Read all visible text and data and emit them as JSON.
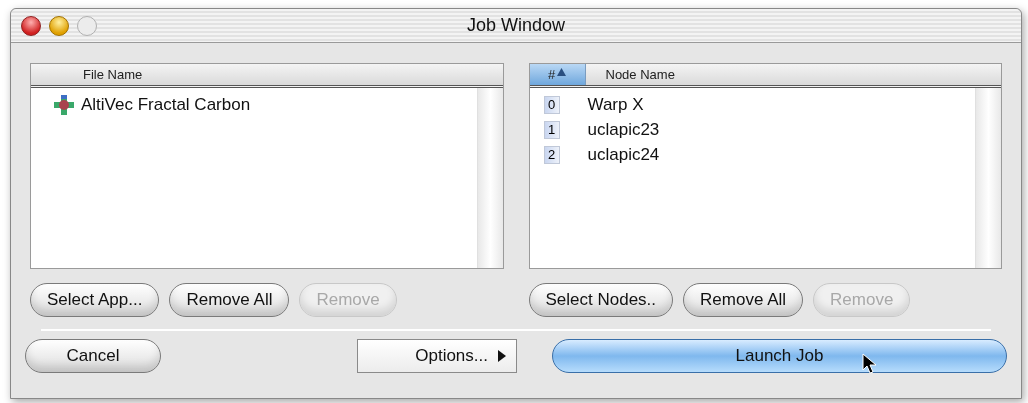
{
  "window": {
    "title": "Job Window"
  },
  "file_table": {
    "columns": [
      {
        "label": "File Name",
        "selected": false
      }
    ],
    "rows": [
      {
        "name": "AltiVec Fractal Carbon"
      }
    ],
    "buttons": [
      {
        "label": "Select App...",
        "disabled": false
      },
      {
        "label": "Remove All",
        "disabled": false
      },
      {
        "label": "Remove",
        "disabled": true
      }
    ]
  },
  "node_table": {
    "columns": [
      {
        "label": "#",
        "selected": true
      },
      {
        "label": "Node Name",
        "selected": false
      }
    ],
    "rows": [
      {
        "index": "0",
        "name": "Warp X"
      },
      {
        "index": "1",
        "name": "uclapic23"
      },
      {
        "index": "2",
        "name": "uclapic24"
      }
    ],
    "buttons": [
      {
        "label": "Select Nodes..",
        "disabled": false
      },
      {
        "label": "Remove All",
        "disabled": false
      },
      {
        "label": "Remove",
        "disabled": true
      }
    ]
  },
  "footer": [
    {
      "kind": "button",
      "label": "Cancel"
    },
    {
      "kind": "popup",
      "label": "Options..."
    },
    {
      "kind": "default",
      "label": "Launch Job"
    }
  ]
}
